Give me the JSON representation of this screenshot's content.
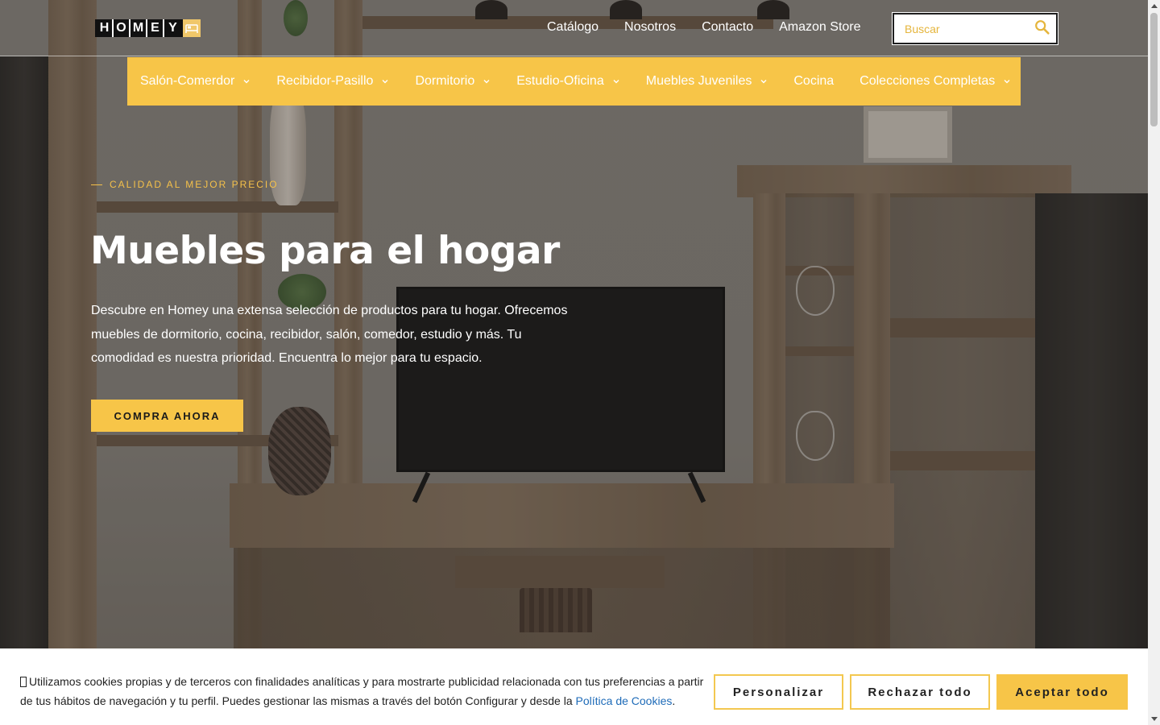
{
  "header": {
    "logo_letters": [
      "H",
      "O",
      "M",
      "E",
      "Y"
    ],
    "logo_icon": "bed-icon",
    "top_links": [
      {
        "label": "Catálogo"
      },
      {
        "label": "Nosotros"
      },
      {
        "label": "Contacto"
      },
      {
        "label": "Amazon Store"
      }
    ],
    "search": {
      "placeholder": "Buscar",
      "icon": "search-icon"
    }
  },
  "categories": [
    {
      "label": "Salón-Comerdor",
      "has_dropdown": true
    },
    {
      "label": "Recibidor-Pasillo",
      "has_dropdown": true
    },
    {
      "label": "Dormitorio",
      "has_dropdown": true
    },
    {
      "label": "Estudio-Oficina",
      "has_dropdown": true
    },
    {
      "label": "Muebles Juveniles",
      "has_dropdown": true
    },
    {
      "label": "Cocina",
      "has_dropdown": false
    },
    {
      "label": "Colecciones Completas",
      "has_dropdown": true
    }
  ],
  "hero": {
    "eyebrow": "CALIDAD AL MEJOR PRECIO",
    "title": "Muebles para el hogar",
    "description": "Descubre en Homey una extensa selección de productos para tu hogar. Ofrecemos muebles de dormitorio, cocina, recibidor, salón, comedor, estudio y más. Tu comodidad es nuestra prioridad. Encuentra lo mejor para tu espacio.",
    "cta_label": "COMPRA AHORA"
  },
  "cookie_banner": {
    "text": "Utilizamos cookies propias y de terceros con finalidades analíticas y para mostrarte publicidad relacionada con tus preferencias a partir de tus hábitos de navegación y tu perfil. Puedes gestionar las mismas a través del botón Configurar y desde la ",
    "policy_link": "Política de Cookies",
    "text_end": ".",
    "buttons": {
      "customize": "Personalizar",
      "reject": "Rechazar todo",
      "accept": "Aceptar todo"
    }
  },
  "colors": {
    "accent": "#f7c548",
    "link": "#1e6bb8",
    "text_dark": "#222222"
  }
}
